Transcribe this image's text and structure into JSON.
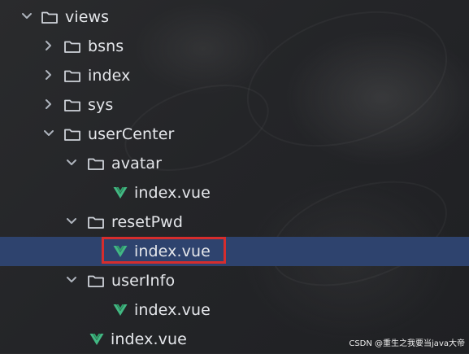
{
  "tree": {
    "items": [
      {
        "label": "views"
      },
      {
        "label": "bsns"
      },
      {
        "label": "index"
      },
      {
        "label": "sys"
      },
      {
        "label": "userCenter"
      },
      {
        "label": "avatar"
      },
      {
        "label": "index.vue"
      },
      {
        "label": "resetPwd"
      },
      {
        "label": "index.vue"
      },
      {
        "label": "userInfo"
      },
      {
        "label": "index.vue"
      },
      {
        "label": "index.vue"
      }
    ]
  },
  "watermark": {
    "text": "CSDN @重生之我要当java大帝"
  },
  "colors": {
    "selection": "#2e436e",
    "highlight_border": "#d62d2d",
    "vue_icon": "#42b883",
    "folder_icon": "#cfd3da"
  }
}
